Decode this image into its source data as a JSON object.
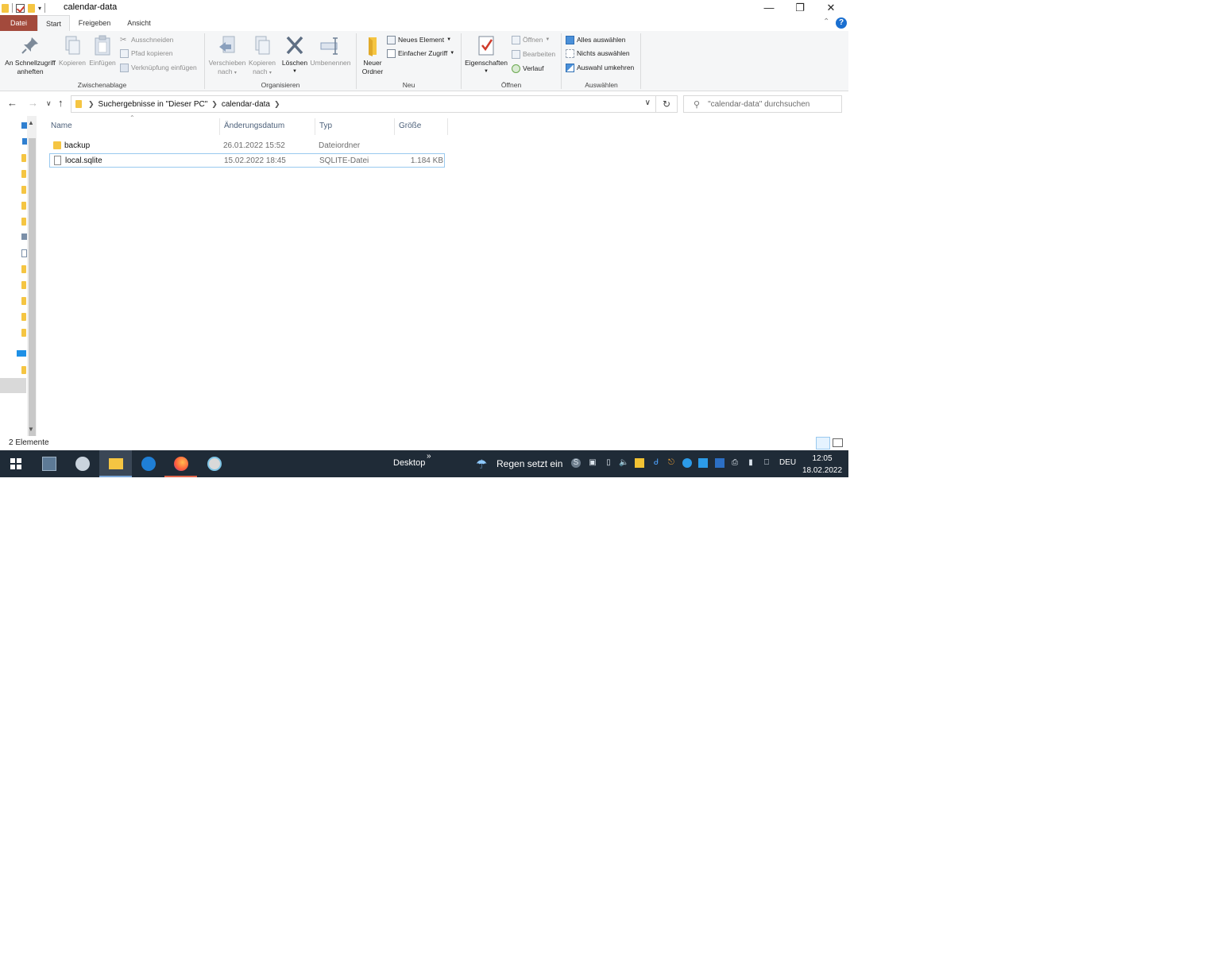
{
  "window": {
    "title": "calendar-data"
  },
  "ribbon_tabs": {
    "datei": "Datei",
    "start": "Start",
    "freigeben": "Freigeben",
    "ansicht": "Ansicht"
  },
  "ribbon": {
    "zwischenablage": {
      "label": "Zwischenablage",
      "pin_line1": "An Schnellzugriff",
      "pin_line2": "anheften",
      "copy": "Kopieren",
      "paste": "Einfügen",
      "cut": "Ausschneiden",
      "copy_path": "Pfad kopieren",
      "paste_shortcut": "Verknüpfung einfügen"
    },
    "organisieren": {
      "label": "Organisieren",
      "move_line1": "Verschieben",
      "move_line2": "nach",
      "copy_line1": "Kopieren",
      "copy_line2": "nach",
      "delete": "Löschen",
      "rename": "Umbenennen"
    },
    "neu": {
      "label": "Neu",
      "new_folder_line1": "Neuer",
      "new_folder_line2": "Ordner",
      "new_item": "Neues Element",
      "easy_access": "Einfacher Zugriff"
    },
    "oeffnen": {
      "label": "Öffnen",
      "properties": "Eigenschaften",
      "open": "Öffnen",
      "edit": "Bearbeiten",
      "history": "Verlauf"
    },
    "auswaehlen": {
      "label": "Auswählen",
      "select_all": "Alles auswählen",
      "select_none": "Nichts auswählen",
      "invert": "Auswahl umkehren"
    }
  },
  "address": {
    "segments": [
      "Suchergebnisse in \"Dieser PC\"",
      "calendar-data"
    ],
    "search_placeholder": "\"calendar-data\" durchsuchen"
  },
  "columns": {
    "name": "Name",
    "date": "Änderungsdatum",
    "type": "Typ",
    "size": "Größe"
  },
  "files": [
    {
      "name": "backup",
      "date": "26.01.2022 15:52",
      "type": "Dateiordner",
      "size": ""
    },
    {
      "name": "local.sqlite",
      "date": "15.02.2022 18:45",
      "type": "SQLITE-Datei",
      "size": "1.184 KB"
    }
  ],
  "status": {
    "count": "2 Elemente"
  },
  "taskbar": {
    "desktop": "Desktop",
    "weather": "Regen setzt ein",
    "language": "DEU",
    "time": "12:05",
    "date": "18.02.2022"
  },
  "colors": {
    "datei_tab": "#a34a3c",
    "taskbar": "#1f2b37",
    "folder": "#f5c542",
    "selection_border": "#99c9ef"
  }
}
